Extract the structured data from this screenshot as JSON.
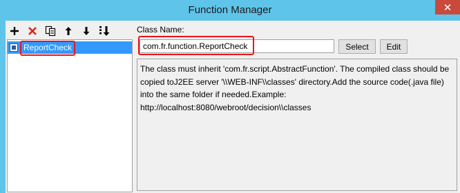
{
  "window": {
    "title": "Function Manager",
    "close_glyph": "✕"
  },
  "toolbar": {
    "items": [
      {
        "name": "add-icon",
        "glyph": "+",
        "color": "#000000"
      },
      {
        "name": "delete-icon",
        "glyph": "✕",
        "color": "#e02020"
      },
      {
        "name": "copy-icon",
        "glyph": "copy",
        "color": "#000000"
      },
      {
        "name": "move-up-icon",
        "glyph": "↑",
        "color": "#000000"
      },
      {
        "name": "move-down-icon",
        "glyph": "↓",
        "color": "#000000"
      },
      {
        "name": "sort-icon",
        "glyph": "sort",
        "color": "#000000"
      }
    ]
  },
  "tree": {
    "items": [
      {
        "label": "ReportCheck",
        "selected": true
      }
    ]
  },
  "details": {
    "class_name_label": "Class Name:",
    "class_name_value": "com.fr.function.ReportCheck",
    "select_label": "Select",
    "edit_label": "Edit",
    "description": "The class must inherit 'com.fr.script.AbstractFunction'. The compiled class should be copied toJ2EE server '\\\\WEB-INF\\\\classes' directory.Add the source code(.java file) into the same folder if needed.Example: http://localhost:8080/webroot/decision\\\\classes"
  },
  "colors": {
    "title_bar": "#5fc4ea",
    "selection": "#3399ff",
    "highlight_red": "#e8161b",
    "close_button": "#c94a3d"
  }
}
